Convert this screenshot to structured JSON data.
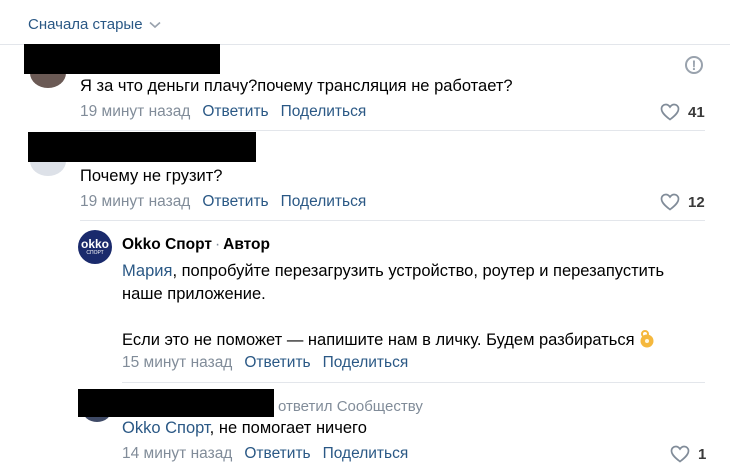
{
  "sort": {
    "label": "Сначала старые"
  },
  "comments": [
    {
      "text": "Я за что деньги плачу?почему трансляция не работает?",
      "time": "19 минут назад",
      "reply_label": "Ответить",
      "share_label": "Поделиться",
      "likes": "41",
      "report_icon": "!"
    },
    {
      "text": "Почему не грузит?",
      "time": "19 минут назад",
      "reply_label": "Ответить",
      "share_label": "Поделиться",
      "likes": "12"
    }
  ],
  "author_reply": {
    "avatar_top": "okko",
    "avatar_bottom": "СПОРТ",
    "author": "Okko Спорт",
    "separator": "·",
    "role": "Автор",
    "mention": "Мария",
    "line1_rest": ", попробуйте перезагрузить устройство, роутер и перезапустить",
    "line2": "наше приложение.",
    "line3": "Если это не поможет — напишите нам в личку. Будем разбираться",
    "time": "15 минут назад",
    "reply_label": "Ответить",
    "share_label": "Поделиться"
  },
  "last_reply": {
    "replied_text": "ответил Сообществу",
    "mention": "Okko Спорт",
    "text_rest": ", не помогает ничего",
    "time": "14 минут назад",
    "reply_label": "Ответить",
    "share_label": "Поделиться",
    "likes": "1"
  },
  "colors": {
    "link": "#2a5885",
    "meta": "#818c99",
    "okko": "#1a2a6c"
  }
}
